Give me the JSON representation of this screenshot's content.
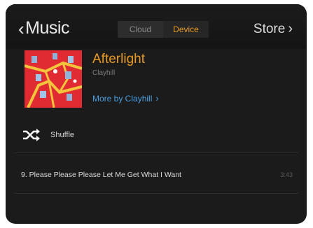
{
  "header": {
    "back_label": "Music",
    "tabs": [
      {
        "label": "Cloud",
        "active": false
      },
      {
        "label": "Device",
        "active": true
      }
    ],
    "store_label": "Store"
  },
  "album": {
    "title": "Afterlight",
    "artist": "Clayhill",
    "more_link": "More by Clayhill"
  },
  "controls": {
    "shuffle_label": "Shuffle"
  },
  "tracks": [
    {
      "label": "9. Please Please Please Let Me Get What I Want",
      "duration": "3:43"
    }
  ],
  "colors": {
    "accent": "#e89a24",
    "link": "#4a9fe2",
    "background": "#1b1b1b",
    "album_art": "#e12b32"
  }
}
